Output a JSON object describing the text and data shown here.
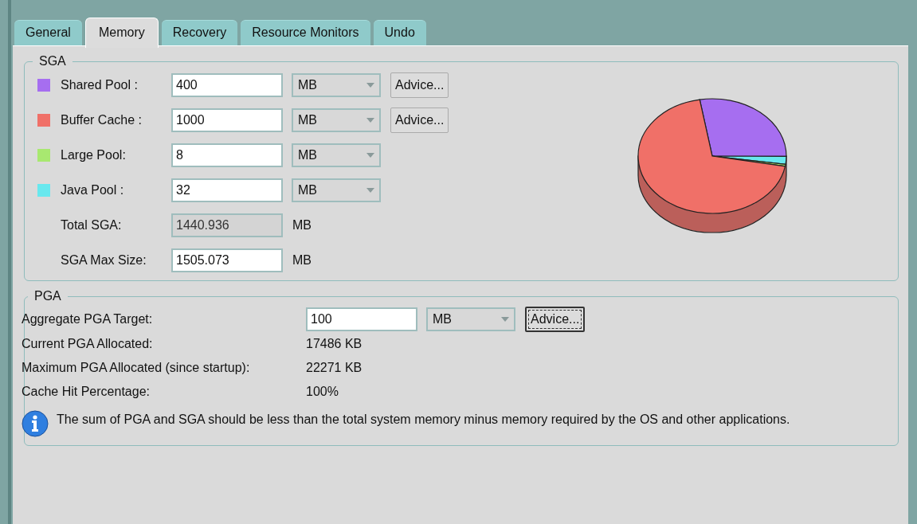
{
  "tabs": [
    {
      "label": "General",
      "selected": false
    },
    {
      "label": "Memory",
      "selected": true
    },
    {
      "label": "Recovery",
      "selected": false
    },
    {
      "label": "Resource Monitors",
      "selected": false
    },
    {
      "label": "Undo",
      "selected": false
    }
  ],
  "sga": {
    "title": "SGA",
    "pools": [
      {
        "label": "Shared Pool :",
        "color": "#a66ef0",
        "value": "400",
        "unit": "MB",
        "advice": "Advice..."
      },
      {
        "label": "Buffer Cache :",
        "color": "#f07068",
        "value": "1000",
        "unit": "MB",
        "advice": "Advice..."
      },
      {
        "label": "Large Pool:",
        "color": "#a8e870",
        "value": "8",
        "unit": "MB"
      },
      {
        "label": "Java Pool :",
        "color": "#68e8ee",
        "value": "32",
        "unit": "MB"
      }
    ],
    "totals": [
      {
        "label": "Total SGA:",
        "value": "1440.936",
        "unit": "MB",
        "disabled": true
      },
      {
        "label": "SGA Max Size:",
        "value": "1505.073",
        "unit": "MB",
        "disabled": false
      }
    ]
  },
  "pga": {
    "title": "PGA",
    "target": {
      "label": "Aggregate PGA Target:",
      "value": "100",
      "unit": "MB",
      "advice": "Advice...",
      "focused": true
    },
    "stats": [
      {
        "label": "Current PGA Allocated:",
        "value": "17486 KB"
      },
      {
        "label": "Maximum PGA Allocated (since startup):",
        "value": "22271 KB"
      },
      {
        "label": "Cache Hit Percentage:",
        "value": "100%"
      }
    ],
    "note": "The sum of PGA and SGA should be less than the total system memory minus memory required by the OS and other applications."
  }
}
